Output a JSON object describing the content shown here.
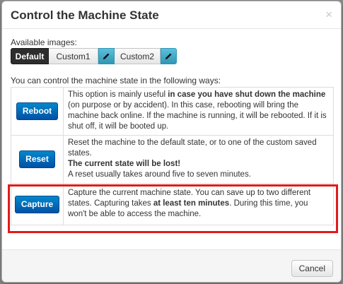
{
  "dialog": {
    "title": "Control the Machine State",
    "close_label": "×"
  },
  "images": {
    "label": "Available images:",
    "buttons": [
      {
        "label": "Default",
        "selected": true
      },
      {
        "label": "Custom1",
        "editable": true,
        "edit_icon": "pencil-icon"
      },
      {
        "label": "Custom2",
        "editable": true,
        "edit_icon": "pencil-icon"
      }
    ]
  },
  "intro": "You can control the machine state in the following ways:",
  "options": [
    {
      "button": "Reboot",
      "desc_pre": "This option is mainly useful ",
      "desc_bold": "in case you have shut down the machine",
      "desc_post": " (on purpose or by accident). In this case, rebooting will bring the machine back online. If the machine is running, it will be rebooted. If it is shut off, it will be booted up."
    },
    {
      "button": "Reset",
      "desc_line1": "Reset the machine to the default state, or to one of the custom saved states.",
      "desc_bold": "The current state will be lost!",
      "desc_line3": "A reset usually takes around five to seven minutes."
    },
    {
      "button": "Capture",
      "desc_pre": "Capture the current machine state. You can save up to two different states. Capturing takes ",
      "desc_bold": "at least ten minutes",
      "desc_post": ". During this time, you won't be able to access the machine.",
      "highlighted": true
    }
  ],
  "footer": {
    "cancel_label": "Cancel"
  },
  "colors": {
    "primary_button": "#0074cc",
    "edit_button": "#49afcd",
    "highlight": "#e11b1b",
    "selected_segment": "#2d2d2d"
  }
}
